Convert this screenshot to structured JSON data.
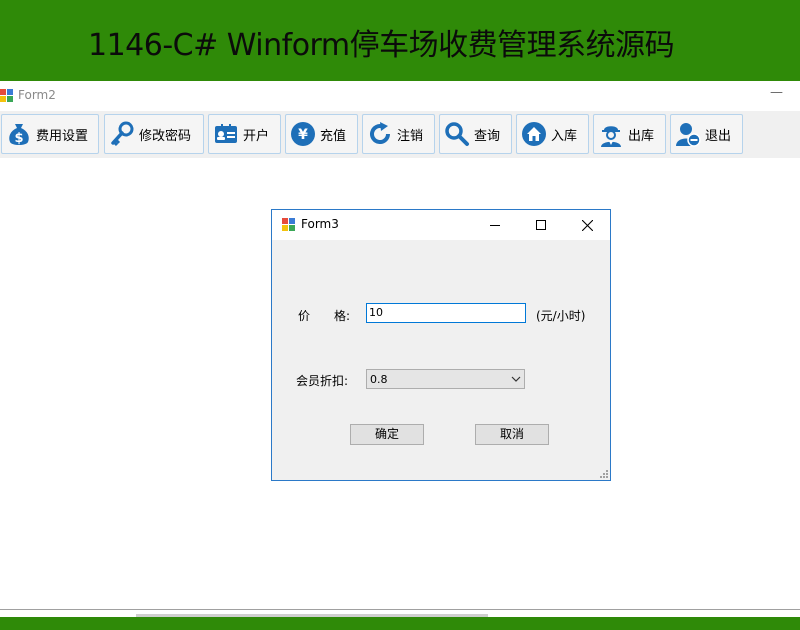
{
  "banner": {
    "title": "1146-C# Winform停车场收费管理系统源码"
  },
  "form2": {
    "title": "Form2",
    "minimize_glyph": "—",
    "toolbar": [
      {
        "label": "费用设置",
        "icon": "money-bag-icon"
      },
      {
        "label": "修改密码",
        "icon": "key-icon"
      },
      {
        "label": "开户",
        "icon": "id-card-icon"
      },
      {
        "label": "充值",
        "icon": "yen-coin-icon"
      },
      {
        "label": "注销",
        "icon": "refresh-icon"
      },
      {
        "label": "查询",
        "icon": "search-icon"
      },
      {
        "label": "入库",
        "icon": "home-icon"
      },
      {
        "label": "出库",
        "icon": "worker-icon"
      },
      {
        "label": "退出",
        "icon": "user-logout-icon"
      }
    ]
  },
  "form3": {
    "title": "Form3",
    "price_label_a": "价",
    "price_label_b": "格:",
    "price_value": "10",
    "price_unit": "(元/小时)",
    "discount_label": "会员折扣:",
    "discount_value": "0.8",
    "ok_label": "确定",
    "cancel_label": "取消"
  },
  "colors": {
    "banner_green": "#2f8a08",
    "accent_blue": "#1e6fb8",
    "focus_border": "#0078d7"
  }
}
